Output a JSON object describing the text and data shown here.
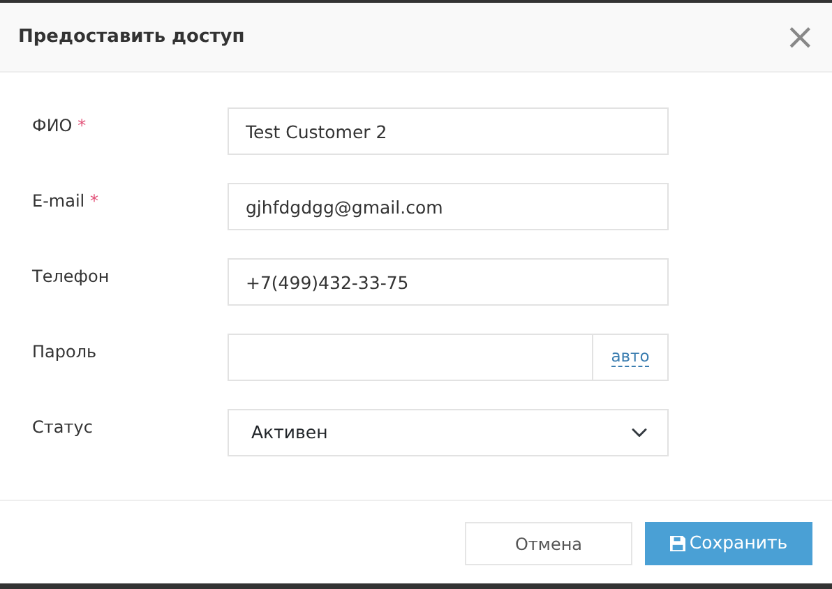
{
  "dialog": {
    "title": "Предоставить доступ",
    "close": "×"
  },
  "fields": [
    {
      "kind": "text",
      "label": "ФИО",
      "required": true,
      "value": "Test Customer 2"
    },
    {
      "kind": "text",
      "label": "E-mail",
      "required": true,
      "value": "gjhfdgdgg@gmail.com"
    },
    {
      "kind": "text",
      "label": "Телефон",
      "required": false,
      "value": "+7(499)432-33-75"
    },
    {
      "kind": "password",
      "label": "Пароль",
      "required": false,
      "addon": "авто"
    },
    {
      "kind": "select",
      "label": "Статус",
      "required": false,
      "value": "Активен"
    }
  ],
  "required_mark": "*",
  "buttons": [
    {
      "kind": "cancel",
      "label": "Отмена"
    },
    {
      "kind": "save",
      "label": "Сохранить"
    }
  ]
}
